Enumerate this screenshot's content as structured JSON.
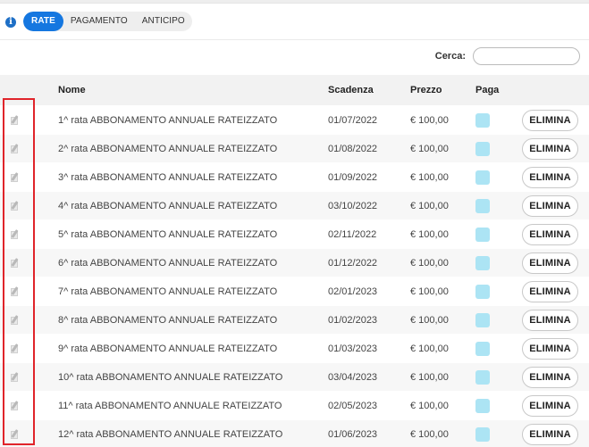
{
  "tabs": {
    "items": [
      {
        "label": "RATE",
        "active": true
      },
      {
        "label": "PAGAMENTO",
        "active": false
      },
      {
        "label": "ANTICIPO",
        "active": false
      }
    ]
  },
  "search": {
    "label": "Cerca:",
    "value": "",
    "placeholder": ""
  },
  "table": {
    "headers": {
      "edit": "",
      "name": "Nome",
      "due": "Scadenza",
      "price": "Prezzo",
      "pay": "Paga",
      "actions": ""
    },
    "delete_label": "ELIMINA",
    "rows": [
      {
        "name": "1^ rata ABBONAMENTO ANNUALE RATEIZZATO",
        "due": "01/07/2022",
        "price": "€ 100,00"
      },
      {
        "name": "2^ rata ABBONAMENTO ANNUALE RATEIZZATO",
        "due": "01/08/2022",
        "price": "€ 100,00"
      },
      {
        "name": "3^ rata ABBONAMENTO ANNUALE RATEIZZATO",
        "due": "01/09/2022",
        "price": "€ 100,00"
      },
      {
        "name": "4^ rata ABBONAMENTO ANNUALE RATEIZZATO",
        "due": "03/10/2022",
        "price": "€ 100,00"
      },
      {
        "name": "5^ rata ABBONAMENTO ANNUALE RATEIZZATO",
        "due": "02/11/2022",
        "price": "€ 100,00"
      },
      {
        "name": "6^ rata ABBONAMENTO ANNUALE RATEIZZATO",
        "due": "01/12/2022",
        "price": "€ 100,00"
      },
      {
        "name": "7^ rata ABBONAMENTO ANNUALE RATEIZZATO",
        "due": "02/01/2023",
        "price": "€ 100,00"
      },
      {
        "name": "8^ rata ABBONAMENTO ANNUALE RATEIZZATO",
        "due": "01/02/2023",
        "price": "€ 100,00"
      },
      {
        "name": "9^ rata ABBONAMENTO ANNUALE RATEIZZATO",
        "due": "01/03/2023",
        "price": "€ 100,00"
      },
      {
        "name": "10^ rata ABBONAMENTO ANNUALE RATEIZZATO",
        "due": "03/04/2023",
        "price": "€ 100,00"
      },
      {
        "name": "11^ rata ABBONAMENTO ANNUALE RATEIZZATO",
        "due": "02/05/2023",
        "price": "€ 100,00"
      },
      {
        "name": "12^ rata ABBONAMENTO ANNUALE RATEIZZATO",
        "due": "01/06/2023",
        "price": "€ 100,00"
      }
    ]
  },
  "icons": {
    "info": "info-icon",
    "edit": "edit-icon"
  },
  "colors": {
    "accent": "#1577e0",
    "pay_swatch": "#ace4f4",
    "highlight": "#e0242a"
  }
}
